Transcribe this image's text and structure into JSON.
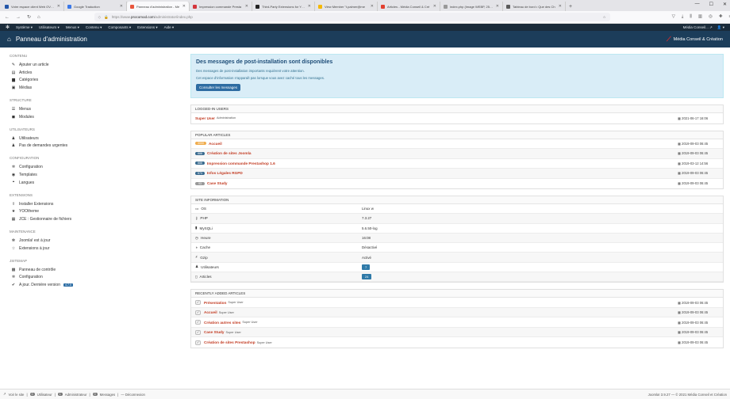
{
  "browser": {
    "tabs": [
      {
        "title": "Votre espace client Web OVHcl",
        "color": "#2456a8",
        "active": false
      },
      {
        "title": "Google Traduction",
        "color": "#3b78e7",
        "active": false
      },
      {
        "title": "Panneau d'administration - Mé",
        "color": "#e8563d",
        "active": true
      },
      {
        "title": "Impression commande Presta",
        "color": "#d4353b",
        "active": false
      },
      {
        "title": "Third-Party Extensions for YOO",
        "color": "#222222",
        "active": false
      },
      {
        "title": "View Member \"t.palmer@me",
        "color": "#f5b800",
        "active": false
      },
      {
        "title": "Articles - Média Conseil & Cré",
        "color": "#e24030",
        "active": false
      },
      {
        "title": "index.php (Image WEBP, 2560 ×",
        "color": "#999999",
        "active": false
      },
      {
        "title": "Tableau de bord • Que des Ch",
        "color": "#5a5a5a",
        "active": false
      }
    ],
    "url_prefix": "https://www.",
    "url_host": "procomod.com",
    "url_path": "/administrator/index.php"
  },
  "topmenu": {
    "items": [
      "Système ▾",
      "Utilisateurs ▾",
      "Menus ▾",
      "Contenu ▾",
      "Composants ▾",
      "Extensions ▾",
      "Aide ▾"
    ],
    "site_name": "Média Conseil... ↗",
    "user": "👤 ▾"
  },
  "header": {
    "title": "Panneau d'administration",
    "brand": "Média Conseil & Création"
  },
  "sidebar": {
    "sections": [
      {
        "title": "CONTENU",
        "items": [
          {
            "icon": "pencil-icon",
            "glyph": "✎",
            "label": "Ajouter un article"
          },
          {
            "icon": "article-icon",
            "glyph": "▤",
            "label": "Articles"
          },
          {
            "icon": "folder-icon",
            "glyph": "▆",
            "label": "Catégories"
          },
          {
            "icon": "image-icon",
            "glyph": "▣",
            "label": "Médias"
          }
        ]
      },
      {
        "title": "STRUCTURE",
        "items": [
          {
            "icon": "list-icon",
            "glyph": "☰",
            "label": "Menus"
          },
          {
            "icon": "cube-icon",
            "glyph": "◼",
            "label": "Modules"
          }
        ]
      },
      {
        "title": "UTILISATEURS",
        "items": [
          {
            "icon": "user-icon",
            "glyph": "♟",
            "label": "Utilisateurs"
          },
          {
            "icon": "user-icon",
            "glyph": "♟",
            "label": "Pas de demandes urgentes"
          }
        ]
      },
      {
        "title": "CONFIGURATION",
        "items": [
          {
            "icon": "gear-icon",
            "glyph": "✲",
            "label": "Configuration"
          },
          {
            "icon": "eye-icon",
            "glyph": "◉",
            "label": "Templates"
          },
          {
            "icon": "comment-icon",
            "glyph": "❝",
            "label": "Langues"
          }
        ]
      },
      {
        "title": "EXTENSIONS",
        "items": [
          {
            "icon": "upload-icon",
            "glyph": "⇪",
            "label": "Installer Extensions"
          },
          {
            "icon": "star-icon",
            "glyph": "★",
            "label": "YOOtheme"
          },
          {
            "icon": "grid-icon",
            "glyph": "▦",
            "label": "JCE : Gestionnaire de fichiers"
          }
        ]
      },
      {
        "title": "MAINTENANCE",
        "items": [
          {
            "icon": "joomla-icon",
            "glyph": "✻",
            "label": "Joomla! est à jour"
          },
          {
            "icon": "star-outline-icon",
            "glyph": "☆",
            "label": "Extensions à jour"
          }
        ]
      },
      {
        "title": "JSITEMAP",
        "items": [
          {
            "icon": "sitemap-icon",
            "glyph": "▩",
            "label": "Panneau de contrôle"
          },
          {
            "icon": "gear-icon",
            "glyph": "✲",
            "label": "Configuration"
          },
          {
            "icon": "check-icon",
            "glyph": "✔",
            "label": "A jour. Dernière version",
            "badge": "4.7.0"
          }
        ]
      }
    ]
  },
  "postinstall": {
    "title": "Des messages de post-installation sont disponibles",
    "line1": "Des messages de post-installation importants requièrent votre attention.",
    "line2": "Cet espace d'information n'apparaît pas lorsque vous avez caché tous les messages.",
    "button": "Consulter les messages"
  },
  "logged": {
    "heading": "LOGGED-IN USERS",
    "rows": [
      {
        "name": "Super User",
        "sub": "Administration",
        "date": "2021-06-17 16:06"
      }
    ]
  },
  "popular": {
    "heading": "POPULAR ARTICLES",
    "rows": [
      {
        "hits": "3000",
        "color": "#f0ad4e",
        "title": "Accueil",
        "date": "2019-09-03 06:45"
      },
      {
        "hits": "888",
        "color": "#3a6b8f",
        "title": "Création de sites Joomla",
        "date": "2019-09-03 06:45"
      },
      {
        "hits": "888",
        "color": "#3a6b8f",
        "title": "Impression commande Prestashop 1.6",
        "date": "2019-03-12 14:56"
      },
      {
        "hits": "573",
        "color": "#3a6b8f",
        "title": "Infos Légales RGPD",
        "date": "2019-09-03 06:45"
      },
      {
        "hits": "93",
        "color": "#999999",
        "title": "Case Study",
        "date": "2019-09-03 06:45"
      }
    ]
  },
  "siteinfo": {
    "heading": "SITE INFORMATION",
    "rows": [
      {
        "icon": "monitor-icon",
        "glyph": "▭",
        "key": "OS",
        "value": "Linux w",
        "badge": false
      },
      {
        "icon": "key-icon",
        "glyph": "⚷",
        "key": "PHP",
        "value": "7.3.27",
        "badge": false
      },
      {
        "icon": "database-icon",
        "glyph": "▮",
        "key": "MySQLi",
        "value": "5.6.50-log",
        "badge": false
      },
      {
        "icon": "clock-icon",
        "glyph": "◷",
        "key": "Heure",
        "value": "16:08",
        "badge": false
      },
      {
        "icon": "gauge-icon",
        "glyph": "◑",
        "key": "Cache",
        "value": "Désactivé",
        "badge": false
      },
      {
        "icon": "lightning-icon",
        "glyph": "⚡",
        "key": "Gzip",
        "value": "Activé",
        "badge": false
      },
      {
        "icon": "users-icon",
        "glyph": "♟",
        "key": "Utilisateurs",
        "value": "7",
        "badge": true
      },
      {
        "icon": "file-icon",
        "glyph": "▯",
        "key": "Articles",
        "value": "24",
        "badge": true
      }
    ]
  },
  "recent": {
    "heading": "RECENTLY ADDED ARTICLES",
    "rows": [
      {
        "title": "Présentation",
        "author": "Super User",
        "date": "2019-09-03 06:45"
      },
      {
        "title": "Accueil",
        "author": "Super User",
        "date": "2019-09-03 06:45"
      },
      {
        "title": "Création autres sites",
        "author": "Super User",
        "date": "2019-09-03 06:45"
      },
      {
        "title": "Case Study",
        "author": "Super User",
        "date": "2019-09-03 06:45"
      },
      {
        "title": "Création de sites Prestashop",
        "author": "Super User",
        "date": "2019-09-03 06:45"
      }
    ]
  },
  "status": {
    "voir_site": "Voir le site",
    "visitors": "0",
    "visitors_label": "Utilisateur",
    "admins": "1",
    "admins_label": "Administrateur",
    "messages": "0",
    "messages_label": "Messages",
    "logout": "— Déconnexion",
    "footer": "Joomla! 3.9.27 — © 2021 Média Conseil et Création"
  }
}
